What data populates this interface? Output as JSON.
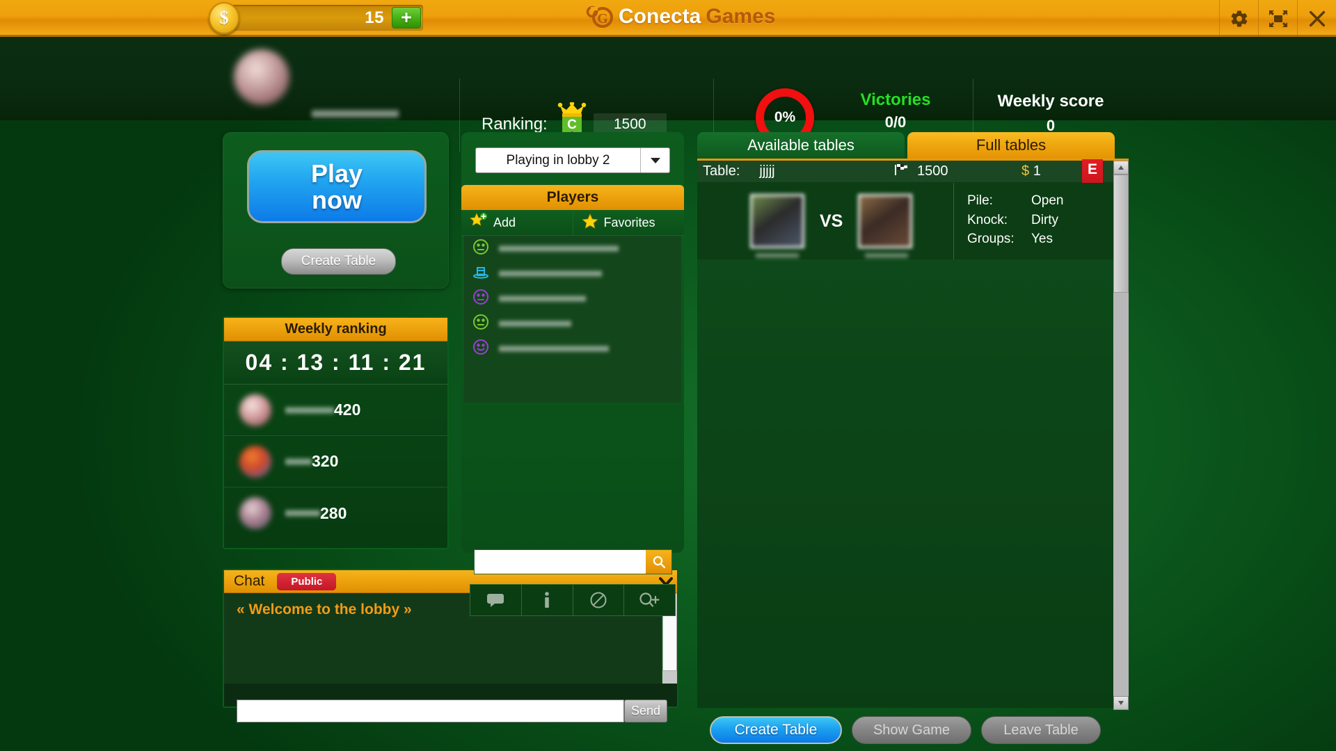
{
  "topbar": {
    "coin_icon": "dollar-coin-icon",
    "coin_value": "15",
    "plus_label": "+",
    "logo_first": "Conecta",
    "logo_second": "Games",
    "settings_icon": "gear-icon",
    "fullscreen_icon": "fullscreen-icon",
    "close_icon": "close-icon"
  },
  "profile": {
    "ranking_label": "Ranking:",
    "rank_letter": "C",
    "rank_value": "1500",
    "percent": "0%",
    "percent_color": "#f10f0f",
    "victories_label": "Victories",
    "victories_value": "0/0",
    "victories_color": "#24e024",
    "weekly_score_label": "Weekly score",
    "weekly_score_value": "0"
  },
  "play_panel": {
    "play_line1": "Play",
    "play_line2": "now",
    "create_table": "Create Table"
  },
  "weekly_ranking": {
    "title": "Weekly ranking",
    "timer": "04 : 13 : 11 : 21",
    "rows": [
      {
        "points": "420"
      },
      {
        "points": "320"
      },
      {
        "points": "280"
      }
    ]
  },
  "chat": {
    "title": "Chat",
    "scope_badge": "Public",
    "scope_color": "#c31626",
    "message": "« Welcome to the lobby »",
    "input_value": "",
    "input_placeholder": "",
    "send_label": "Send",
    "collapse_icon": "chevron-down-icon"
  },
  "players": {
    "lobby_selected": "Playing in lobby 2",
    "dropdown_icon": "chevron-down-icon",
    "title": "Players",
    "add_label": "Add",
    "add_icon": "star-plus-icon",
    "favorites_label": "Favorites",
    "favorites_icon": "star-icon",
    "list": [
      {
        "icon": "neutral-face-icon",
        "color": "#7ac832"
      },
      {
        "icon": "top-hat-icon",
        "color": "#23b8e8"
      },
      {
        "icon": "neutral-face-icon",
        "color": "#9b3fd4"
      },
      {
        "icon": "neutral-face-icon",
        "color": "#7ac832"
      },
      {
        "icon": "smiley-face-icon",
        "color": "#9b3fd4"
      }
    ],
    "search_value": "",
    "search_placeholder": "",
    "search_icon": "search-icon",
    "tools": [
      {
        "icon": "chat-bubble-icon"
      },
      {
        "icon": "info-icon"
      },
      {
        "icon": "block-icon"
      },
      {
        "icon": "zoom-in-icon"
      }
    ]
  },
  "tables": {
    "tab_available": "Available tables",
    "tab_full": "Full tables",
    "active_tab": "Full tables",
    "row": {
      "table_label": "Table:",
      "table_name": "jjjjj",
      "flag_icon": "checkered-flag-icon",
      "rating": "1500",
      "currency": "$",
      "bet": "1",
      "badge": "E",
      "badge_color": "#e31c24",
      "vs_label": "VS",
      "details": [
        {
          "key": "Pile:",
          "value": "Open"
        },
        {
          "key": "Knock:",
          "value": "Dirty"
        },
        {
          "key": "Groups:",
          "value": "Yes"
        }
      ]
    },
    "scroll_up_icon": "caret-up-icon",
    "scroll_down_icon": "caret-down-icon"
  },
  "footer": {
    "create_table": "Create Table",
    "show_game": "Show Game",
    "leave_table": "Leave Table"
  }
}
